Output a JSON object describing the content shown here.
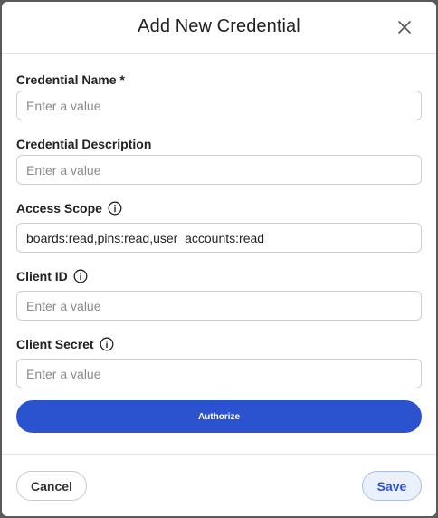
{
  "dialog": {
    "title": "Add New Credential",
    "close_icon": "close-icon"
  },
  "form": {
    "credential_name": {
      "label": "Credential Name *",
      "value": "",
      "placeholder": "Enter a value"
    },
    "credential_description": {
      "label": "Credential Description",
      "value": "",
      "placeholder": "Enter a value"
    },
    "access_scope": {
      "label": "Access Scope",
      "value": "boards:read,pins:read,user_accounts:read",
      "placeholder": "",
      "info_icon": "info-icon"
    },
    "client_id": {
      "label": "Client ID",
      "value": "",
      "placeholder": "Enter a value",
      "info_icon": "info-icon"
    },
    "client_secret": {
      "label": "Client Secret",
      "value": "",
      "placeholder": "Enter a value",
      "info_icon": "info-icon"
    },
    "authorize_label": "Authorize"
  },
  "footer": {
    "cancel_label": "Cancel",
    "save_label": "Save"
  },
  "colors": {
    "accent": "#2b53cf",
    "save_bg": "#eaf1fc",
    "overlay": "#5a5a5a"
  }
}
